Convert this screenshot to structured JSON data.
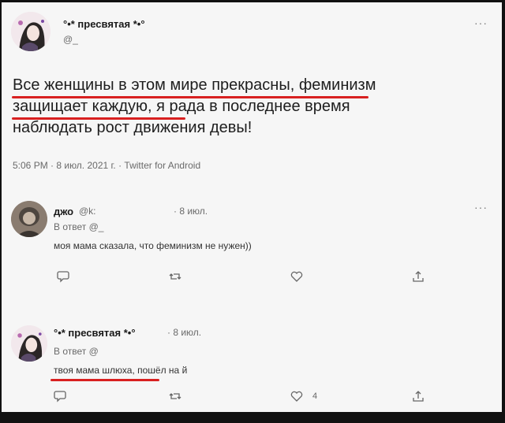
{
  "main_tweet": {
    "display_name": "°•* пресвятая *•°",
    "handle": "@_",
    "text_lines": [
      "Все женщины в этом мире прекрасны, феминизм",
      "защищает каждую, я рада в последнее время",
      "наблюдать рост движения девы!"
    ],
    "meta": "5:06 PM · 8 июл. 2021 г. · Twitter for Android"
  },
  "reply1": {
    "display_name": "джо",
    "handle": "@k:",
    "date": "· 8 июл.",
    "reply_to": "В ответ @_",
    "text": "моя мама сказала, что феминизм не нужен))"
  },
  "reply2": {
    "display_name": "°•* пресвятая *•°",
    "date": "· 8 июл.",
    "reply_to": "В ответ @",
    "text": "твоя мама шлюха, пошёл на   й",
    "like_count": "4"
  },
  "icons": {
    "comment": "comment-icon",
    "retweet": "retweet-icon",
    "like": "heart-icon",
    "share": "share-icon",
    "more": "more-icon"
  },
  "colors": {
    "underline": "#d82020",
    "background": "#f6f6f6"
  }
}
